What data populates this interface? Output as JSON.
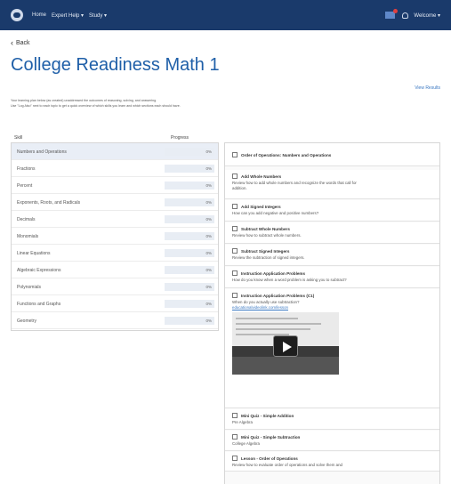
{
  "nav": {
    "items": [
      "Home",
      "Expert Help ▾",
      "Study ▾"
    ],
    "user": "Welcome ▾"
  },
  "back_label": "Back",
  "title": "College Readiness Math 1",
  "view_results_label": "View Results",
  "intro": [
    "Your learning plan below (as created) unaddressed the outcomes of reasoning, solving, and answering.",
    "Use \"Log Also\" next to each topic to get a quick overview of which skills you learn and which sections each should have."
  ],
  "skills": {
    "header_skill": "Skill",
    "header_progress": "Progress",
    "items": [
      {
        "name": "Numbers and Operations",
        "progress": "0%",
        "fraction": 0
      },
      {
        "name": "Fractions",
        "progress": "0%",
        "fraction": 0
      },
      {
        "name": "Percent",
        "progress": "0%",
        "fraction": 0
      },
      {
        "name": "Exponents, Roots, and Radicals",
        "progress": "0%",
        "fraction": 0
      },
      {
        "name": "Decimals",
        "progress": "0%",
        "fraction": 0
      },
      {
        "name": "Monomials",
        "progress": "0%",
        "fraction": 0
      },
      {
        "name": "Linear Equations",
        "progress": "0%",
        "fraction": 0
      },
      {
        "name": "Algebraic Expressions",
        "progress": "0%",
        "fraction": 0
      },
      {
        "name": "Polynomials",
        "progress": "0%",
        "fraction": 0
      },
      {
        "name": "Functions and Graphs",
        "progress": "0%",
        "fraction": 0
      },
      {
        "name": "Geometry",
        "progress": "0%",
        "fraction": 0
      }
    ]
  },
  "lessons": {
    "header": "Order of Operations: Numbers and Operations",
    "items": [
      {
        "title": "Add Whole Numbers",
        "sub": [
          "Review how to add whole numbers and recognize the words that call for",
          "addition."
        ]
      },
      {
        "title": "Add Signed Integers",
        "sub": [
          "How can you add negative and positive numbers?"
        ]
      },
      {
        "title": "Subtract Whole Numbers",
        "sub": [
          "Review how to subtract whole numbers."
        ]
      },
      {
        "title": "Subtract Signed Integers",
        "sub": [
          "Review the subtraction of signed integers."
        ]
      },
      {
        "title": "Instruction Application Problems",
        "sub": [
          "How do you know when a word problem is asking you to subtract?"
        ]
      },
      {
        "title": "Instruction Application Problems (C1)",
        "sub": [
          "When do you actually use subtraction?"
        ],
        "link": "educationalvideolink.com/lesson"
      },
      {
        "title": "Mini Quiz - Simple Addition",
        "sub": [
          "Pre Algebra"
        ]
      },
      {
        "title": "Mini Quiz - Simple Subtraction",
        "sub": [
          "College Algebra"
        ]
      },
      {
        "title": "Lesson - Order of Operations",
        "sub": [
          "Review how to evaluate order of operations and solve them and"
        ]
      }
    ]
  }
}
